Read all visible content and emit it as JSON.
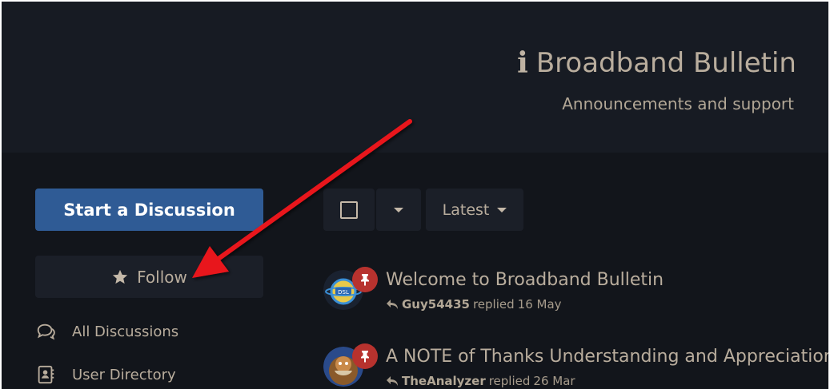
{
  "hero": {
    "title": "Broadband Bulletin",
    "subtitle": "Announcements and support"
  },
  "sidebar": {
    "start_label": "Start a Discussion",
    "follow_label": "Follow",
    "items": [
      {
        "label": "All Discussions",
        "icon": "comments-icon"
      },
      {
        "label": "User Directory",
        "icon": "address-book-icon"
      }
    ]
  },
  "toolbar": {
    "sort_label": "Latest"
  },
  "discussions": [
    {
      "title": "Welcome to Broadband Bulletin",
      "user": "Guy54435",
      "action": "replied",
      "time": "16 May"
    },
    {
      "title": "A NOTE of Thanks Understanding and Appreciation t",
      "user": "TheAnalyzer",
      "action": "replied",
      "time": "26 Mar"
    }
  ],
  "colors": {
    "accent": "#2f5b95",
    "pin": "#b7322e",
    "annotation_arrow": "#e8141a"
  }
}
